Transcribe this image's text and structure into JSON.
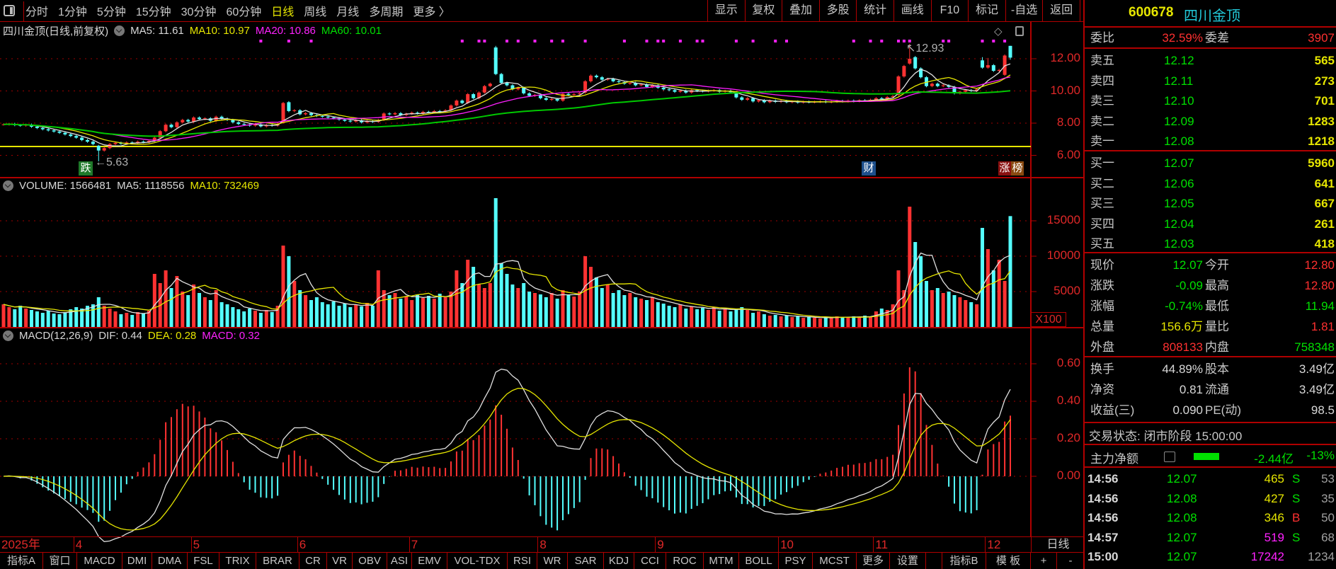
{
  "toolbar": {
    "left": [
      "分时",
      "1分钟",
      "5分钟",
      "15分钟",
      "30分钟",
      "60分钟",
      "日线",
      "周线",
      "月线",
      "多周期",
      "更多 〉"
    ],
    "active": "日线",
    "right": [
      "显示",
      "复权",
      "叠加",
      "多股",
      "统计",
      "画线",
      "F10",
      "标记",
      "-自选",
      "返回"
    ]
  },
  "main_legend": {
    "title": "四川金顶(日线,前复权)",
    "ma5": "MA5: 11.61",
    "ma10": "MA10: 10.97",
    "ma20": "MA20: 10.86",
    "ma60": "MA60: 10.01"
  },
  "volume_legend": {
    "vol": "VOLUME: 1566481",
    "ma5": "MA5: 1118556",
    "ma10": "MA10: 732469",
    "unit": "X100"
  },
  "macd_legend": {
    "name": "MACD(12,26,9)",
    "dif": "DIF: 0.44",
    "dea": "DEA: 0.28",
    "macd": "MACD: 0.32"
  },
  "annotations": {
    "low_badge": "跌",
    "low_label": "←5.63",
    "high_label": "↖12.93",
    "fin_badge": "财",
    "rank_badge_1": "涨",
    "rank_badge_2": "榜"
  },
  "chart_data": {
    "type": "candlestick",
    "price_axis": [
      "12.00",
      "10.00",
      "8.00",
      "6.00"
    ],
    "price_ticks": [
      12,
      10,
      8,
      6
    ],
    "volume_axis": [
      "15000",
      "10000",
      "5000"
    ],
    "volume_ticks": [
      15000,
      10000,
      5000
    ],
    "macd_axis": [
      "0.60",
      "0.40",
      "0.20",
      "0.00"
    ],
    "macd_ticks": [
      0.6,
      0.4,
      0.2,
      0
    ],
    "reference_line": 6.55,
    "months": [
      {
        "label": "2025年",
        "index": -1
      },
      {
        "label": "4",
        "index": 13
      },
      {
        "label": "5",
        "index": 34
      },
      {
        "label": "6",
        "index": 53
      },
      {
        "label": "7",
        "index": 73
      },
      {
        "label": "8",
        "index": 96
      },
      {
        "label": "9",
        "index": 117
      },
      {
        "label": "10",
        "index": 139
      },
      {
        "label": "11",
        "index": 156
      },
      {
        "label": "12",
        "index": 176
      }
    ],
    "period_label": "日线",
    "close": [
      7.92,
      7.95,
      7.88,
      7.85,
      7.9,
      7.78,
      7.7,
      7.62,
      7.55,
      7.48,
      7.4,
      7.3,
      7.2,
      7.1,
      6.95,
      6.85,
      6.7,
      6.3,
      6.45,
      6.7,
      6.78,
      6.72,
      6.8,
      6.75,
      6.85,
      6.82,
      6.9,
      7.1,
      7.5,
      7.9,
      7.75,
      8.05,
      8.2,
      8.1,
      8.35,
      8.25,
      8.3,
      8.15,
      8.4,
      8.28,
      8.2,
      8.05,
      7.95,
      7.9,
      7.85,
      7.92,
      7.8,
      7.88,
      7.85,
      7.95,
      9.25,
      8.75,
      8.8,
      8.55,
      8.62,
      8.5,
      8.45,
      8.4,
      8.35,
      8.3,
      8.22,
      8.15,
      8.1,
      8.18,
      8.05,
      8.12,
      8.08,
      8.2,
      8.6,
      8.55,
      8.62,
      8.5,
      8.58,
      8.65,
      8.6,
      8.7,
      8.68,
      8.75,
      8.72,
      8.8,
      9.1,
      9.4,
      9.25,
      9.8,
      9.55,
      9.9,
      10.3,
      10.45,
      11.05,
      10.5,
      10.35,
      10.1,
      10.2,
      9.85,
      9.7,
      9.75,
      9.55,
      9.45,
      9.5,
      9.4,
      9.82,
      9.75,
      9.8,
      9.85,
      10.6,
      10.95,
      10.85,
      10.7,
      10.75,
      10.6,
      10.55,
      10.45,
      10.5,
      10.35,
      10.4,
      10.25,
      10.35,
      10.2,
      10.1,
      10.05,
      9.95,
      10.02,
      9.9,
      10.05,
      10.0,
      9.98,
      10.02,
      10.05,
      9.95,
      10.0,
      9.92,
      9.6,
      9.45,
      9.55,
      9.35,
      9.42,
      9.3,
      9.4,
      9.32,
      9.38,
      9.3,
      9.35,
      9.28,
      9.33,
      9.3,
      9.32,
      9.35,
      9.3,
      9.33,
      9.38,
      9.35,
      9.4,
      9.36,
      9.42,
      9.4,
      9.45,
      9.55,
      9.5,
      9.62,
      9.68,
      10.9,
      11.55,
      12.0,
      11.4,
      10.85,
      10.3,
      10.45,
      10.3,
      10.35,
      10.25,
      9.85,
      9.95,
      10.05,
      10.0,
      10.1,
      11.45,
      11.6,
      11.25,
      11.3,
      12.2,
      12.07
    ],
    "open_overrides": {
      "17": 6.6,
      "50": 8.05,
      "51": 9.3,
      "68": 8.2,
      "88": 12.7,
      "104": 9.9,
      "160": 9.75,
      "162": 11.7,
      "163": 12.1,
      "175": 11.9,
      "179": 11.0,
      "180": 12.8
    },
    "high_overrides": {
      "17": 6.65,
      "88": 12.8,
      "162": 12.93,
      "175": 12.1,
      "176": 12.05,
      "180": 12.8
    },
    "low_overrides": {
      "17": 5.63,
      "180": 11.94
    },
    "volume_x100": [
      3200,
      2800,
      2500,
      3000,
      2600,
      2400,
      2200,
      2000,
      2300,
      1900,
      1800,
      2100,
      2500,
      2800,
      2600,
      3000,
      3200,
      4200,
      3000,
      2600,
      2200,
      1800,
      2000,
      1700,
      2100,
      1900,
      2300,
      7500,
      6200,
      8000,
      5500,
      7200,
      5000,
      4500,
      6000,
      4800,
      4200,
      3800,
      5200,
      3500,
      3200,
      2800,
      2500,
      2200,
      2600,
      2300,
      2000,
      2400,
      2100,
      3000,
      11500,
      10000,
      6500,
      5200,
      4500,
      3800,
      4200,
      3500,
      3200,
      3600,
      3000,
      3300,
      2800,
      3100,
      2900,
      3400,
      3000,
      8000,
      5200,
      4500,
      4800,
      4000,
      4300,
      3800,
      4600,
      4100,
      4400,
      4000,
      4700,
      4200,
      5000,
      8000,
      6200,
      9500,
      8500,
      6000,
      5500,
      6200,
      18200,
      9000,
      7500,
      6000,
      5500,
      6200,
      5000,
      4800,
      4600,
      4200,
      4800,
      4000,
      5200,
      4500,
      4300,
      5000,
      10000,
      8500,
      7000,
      5500,
      6000,
      4800,
      5200,
      4500,
      4800,
      4200,
      4000,
      3800,
      4200,
      3500,
      3300,
      3000,
      2800,
      3200,
      2600,
      2900,
      2500,
      2700,
      2400,
      2800,
      2300,
      2600,
      2200,
      2500,
      2800,
      2400,
      2000,
      2200,
      1800,
      1600,
      1700,
      1500,
      1600,
      1400,
      1500,
      1300,
      1400,
      1300,
      1200,
      1400,
      1300,
      1500,
      1400,
      1300,
      1500,
      1400,
      1600,
      1500,
      2200,
      2600,
      2400,
      3200,
      8000,
      5200,
      17000,
      12000,
      10000,
      6500,
      5200,
      5500,
      4800,
      5000,
      4500,
      4200,
      3800,
      3500,
      3200,
      14000,
      11000,
      8000,
      9500,
      6500,
      15665
    ],
    "signal_markers": [
      46,
      51,
      55,
      82,
      85,
      86,
      90,
      92,
      95,
      98,
      100,
      104,
      111,
      115,
      117,
      118,
      121,
      124,
      125,
      131,
      134,
      138,
      140,
      152,
      155,
      157,
      160,
      161,
      162,
      168,
      169,
      175,
      177,
      179
    ],
    "ma_periods": [
      5,
      10,
      20,
      60
    ],
    "macd_params": [
      12,
      26,
      9
    ],
    "colors": {
      "up": "#ff3232",
      "down": "#54ffff",
      "ma5": "#e0e0e0",
      "ma10": "#e6e600",
      "ma20": "#ff20ff",
      "ma60": "#00c800",
      "grid": "#a00000",
      "marker": "#ff20ff",
      "ref": "#e6e600"
    }
  },
  "quote": {
    "code": "600678",
    "name": "四川金顶",
    "weibi_label": "委比",
    "weibi": "32.59%",
    "weicha_label": "委差",
    "weicha": "3907",
    "sells": [
      {
        "label": "卖五",
        "price": "12.12",
        "vol": "565"
      },
      {
        "label": "卖四",
        "price": "12.11",
        "vol": "273"
      },
      {
        "label": "卖三",
        "price": "12.10",
        "vol": "701"
      },
      {
        "label": "卖二",
        "price": "12.09",
        "vol": "1283"
      },
      {
        "label": "卖一",
        "price": "12.08",
        "vol": "1218"
      }
    ],
    "buys": [
      {
        "label": "买一",
        "price": "12.07",
        "vol": "5960"
      },
      {
        "label": "买二",
        "price": "12.06",
        "vol": "641"
      },
      {
        "label": "买三",
        "price": "12.05",
        "vol": "667"
      },
      {
        "label": "买四",
        "price": "12.04",
        "vol": "261"
      },
      {
        "label": "买五",
        "price": "12.03",
        "vol": "418"
      }
    ],
    "stats": {
      "xj_l": "现价",
      "xj": "12.07",
      "jk_l": "今开",
      "jk": "12.80",
      "zd_l": "涨跌",
      "zd": "-0.09",
      "zg_l": "最高",
      "zg": "12.80",
      "zf_l": "涨幅",
      "zf": "-0.74%",
      "zdi_l": "最低",
      "zdi": "11.94",
      "zl_l": "总量",
      "zl": "156.6万",
      "lb_l": "量比",
      "lb": "1.81",
      "wp_l": "外盘",
      "wp": "808133",
      "np_l": "内盘",
      "np": "758348",
      "hs_l": "换手",
      "hs": "44.89%",
      "gb_l": "股本",
      "gb": "3.49亿",
      "jz_l": "净资",
      "jz": "0.81",
      "lt_l": "流通",
      "lt": "3.49亿",
      "sy_l": "收益(三)",
      "sy": "0.090",
      "pe_l": "PE(动)",
      "pe": "98.5"
    },
    "status": "交易状态: 闭市阶段 15:00:00",
    "main_flow_label": "主力净额",
    "main_flow_value": "-2.44亿",
    "main_flow_pct": "-13%",
    "ticks": [
      {
        "time": "14:56",
        "price": "12.07",
        "vol": "465",
        "bs": "S",
        "num": "53"
      },
      {
        "time": "14:56",
        "price": "12.08",
        "vol": "427",
        "bs": "S",
        "num": "35"
      },
      {
        "time": "14:56",
        "price": "12.08",
        "vol": "346",
        "bs": "B",
        "num": "50"
      },
      {
        "time": "14:57",
        "price": "12.07",
        "vol": "519",
        "bs": "S",
        "num": "68"
      },
      {
        "time": "15:00",
        "price": "12.07",
        "vol": "17242",
        "bs": "",
        "num": "1234"
      }
    ]
  },
  "tabs": [
    "指标A",
    "窗口",
    "MACD",
    "DMI",
    "DMA",
    "FSL",
    "TRIX",
    "BRAR",
    "CR",
    "VR",
    "OBV",
    "ASI",
    "EMV",
    "VOL-TDX",
    "RSI",
    "WR",
    "SAR",
    "KDJ",
    "CCI",
    "ROC",
    "MTM",
    "BOLL",
    "PSY",
    "MCST",
    "更多",
    "设置",
    "",
    "指标B",
    "模 板",
    "+",
    "-"
  ],
  "active_tab": "MACD"
}
